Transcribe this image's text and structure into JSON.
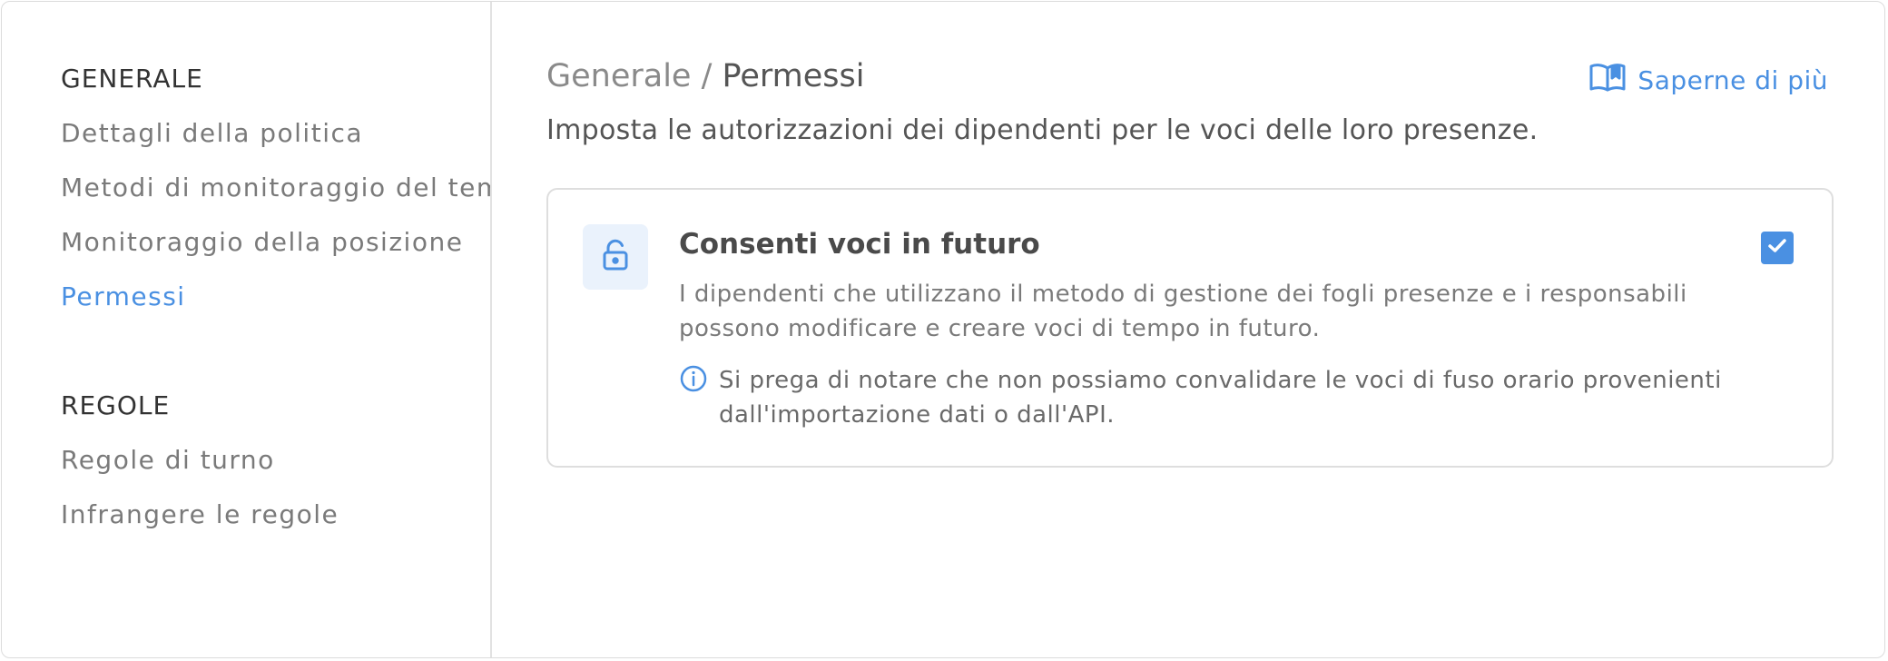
{
  "sidebar": {
    "sections": [
      {
        "title": "GENERALE",
        "items": [
          {
            "label": "Dettagli della politica"
          },
          {
            "label": "Metodi di monitoraggio del tempo"
          },
          {
            "label": "Monitoraggio della posizione"
          },
          {
            "label": "Permessi"
          }
        ]
      },
      {
        "title": "REGOLE",
        "items": [
          {
            "label": "Regole di turno"
          },
          {
            "label": "Infrangere le regole"
          }
        ]
      }
    ],
    "active_item": "Permessi"
  },
  "header": {
    "breadcrumb_parent": "Generale",
    "breadcrumb_separator": " / ",
    "breadcrumb_current": "Permessi",
    "subtitle": "Imposta le autorizzazioni dei dipendenti per le voci delle loro presenze.",
    "learn_more_label": "Saperne di più",
    "learn_more_icon": "book-icon"
  },
  "permission_card": {
    "icon": "lock-icon",
    "title": "Consenti voci in futuro",
    "description": "I dipendenti che utilizzano il metodo di gestione dei fogli presenze e i responsabili possono modificare e creare voci di tempo in futuro.",
    "note_icon": "info-icon",
    "note": "Si prega di notare che non possiamo convalidare le voci di fuso orario provenienti dall'importazione dati o dall'API.",
    "checked": true
  },
  "colors": {
    "accent": "#4a90e2",
    "icon_bg": "#eaf2fc",
    "border": "#dedede"
  }
}
